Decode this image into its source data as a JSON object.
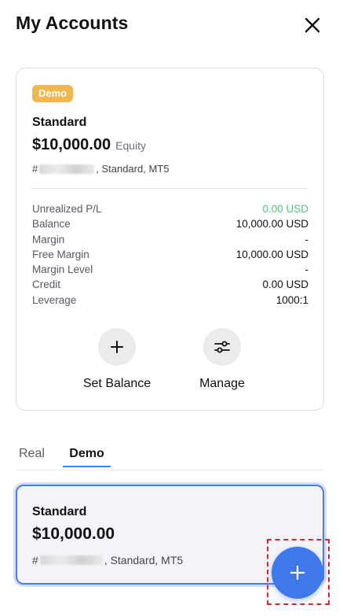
{
  "header": {
    "title": "My Accounts",
    "close_icon": "close-icon"
  },
  "account_card": {
    "badge": "Demo",
    "badge_color": "#f0b64f",
    "type": "Standard",
    "amount": "$10,000.00",
    "amount_caption": "Equity",
    "meta_prefix": "#",
    "meta_suffix": ", Standard, MT5",
    "stats": [
      {
        "label": "Unrealized P/L",
        "value": "0.00 USD",
        "color": "#56c080"
      },
      {
        "label": "Balance",
        "value": "10,000.00 USD"
      },
      {
        "label": "Margin",
        "value": "-"
      },
      {
        "label": "Free Margin",
        "value": "10,000.00 USD"
      },
      {
        "label": "Margin Level",
        "value": "-"
      },
      {
        "label": "Credit",
        "value": "0.00 USD"
      },
      {
        "label": "Leverage",
        "value": "1000:1"
      }
    ],
    "actions": [
      {
        "label": "Set Balance",
        "icon": "plus-icon"
      },
      {
        "label": "Manage",
        "icon": "sliders-icon"
      }
    ]
  },
  "tabs": [
    {
      "label": "Real",
      "active": false
    },
    {
      "label": "Demo",
      "active": true
    }
  ],
  "demo_list": {
    "items": [
      {
        "type": "Standard",
        "amount": "$10,000.00",
        "meta_prefix": "#",
        "meta_suffix": ", Standard, MT5",
        "selected": true
      }
    ]
  },
  "fab": {
    "icon": "plus-icon",
    "color": "#3f78e8"
  },
  "accent_color": "#3b82f6"
}
